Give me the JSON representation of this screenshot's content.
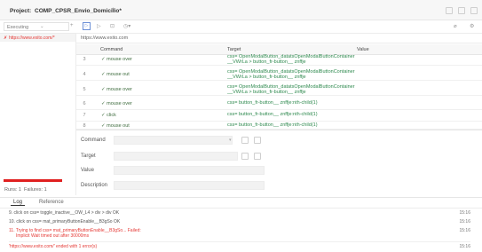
{
  "header": {
    "project_label": "Project:",
    "project_name": "COMP_CPSR_Envio_Domicilio*"
  },
  "toolbar": {
    "executing_label": "Executing"
  },
  "sidebar": {
    "test_case": "https://www.exito.com/*",
    "runs_label": "Runs: 1",
    "failures_label": "Failures: 1"
  },
  "url_bar": {
    "value": "https://www.exito.com"
  },
  "table": {
    "headers": {
      "command": "Command",
      "target": "Target",
      "value": "Value"
    },
    "rows": [
      {
        "index": "3",
        "command": "✓ mouse over",
        "target": [
          "css= OpenModalButton_datatsOpenModalButtonContainer",
          "__VWrLa > button_fr-button__ znffje"
        ]
      },
      {
        "index": "4",
        "command": "✓ mouse out",
        "target": [
          "css= OpenModalButton_datatsOpenModalButtonContainer",
          "__VWrLa > button_fr-button__ znffje"
        ]
      },
      {
        "index": "5",
        "command": "✓ mouse over",
        "target": [
          "css= OpenModalButton_datatsOpenModalButtonContainer",
          "__VWrLa > button_fr-button__ znffje"
        ]
      },
      {
        "index": "6",
        "command": "✓ mouse over",
        "target": [
          "css= button_fr-button__ znffje:nth-child(1)"
        ]
      },
      {
        "index": "7",
        "command": "✓ click",
        "target": [
          "css= button_fr-button__ znffje:nth-child(1)"
        ]
      },
      {
        "index": "8",
        "command": "✓ mouse out",
        "target": [
          "css= button_fr-button__ znffje:nth-child(1)"
        ]
      }
    ]
  },
  "form": {
    "command_label": "Command",
    "target_label": "Target",
    "value_label": "Value",
    "description_label": "Description"
  },
  "bottom_tabs": {
    "log": "Log",
    "reference": "Reference"
  },
  "log": [
    {
      "text": "9.  click on css= toggle_inactive__OW_L4 > div > div OK",
      "time": "15:16",
      "status": "ok"
    },
    {
      "text": "10. click on css= mat_primaryButtonEnable__B3gSo OK",
      "time": "15:16",
      "status": "ok"
    },
    {
      "text": "11. Trying to find css= mat_primaryButtonEnable__B3gSo... Failed:",
      "time": "15:16",
      "status": "fail"
    },
    {
      "text": "Implicit Wait timed out after 30000ms",
      "time": "",
      "status": "fail"
    },
    {
      "text": "'https://www.exito.com/' ended with 1 error(s)",
      "time": "15:16",
      "status": "fail"
    }
  ],
  "colors": {
    "ok_green": "#2f8a4f",
    "fail_red": "#e53935",
    "red_bar": "#e02020",
    "header_bg": "#f7f7f7"
  }
}
